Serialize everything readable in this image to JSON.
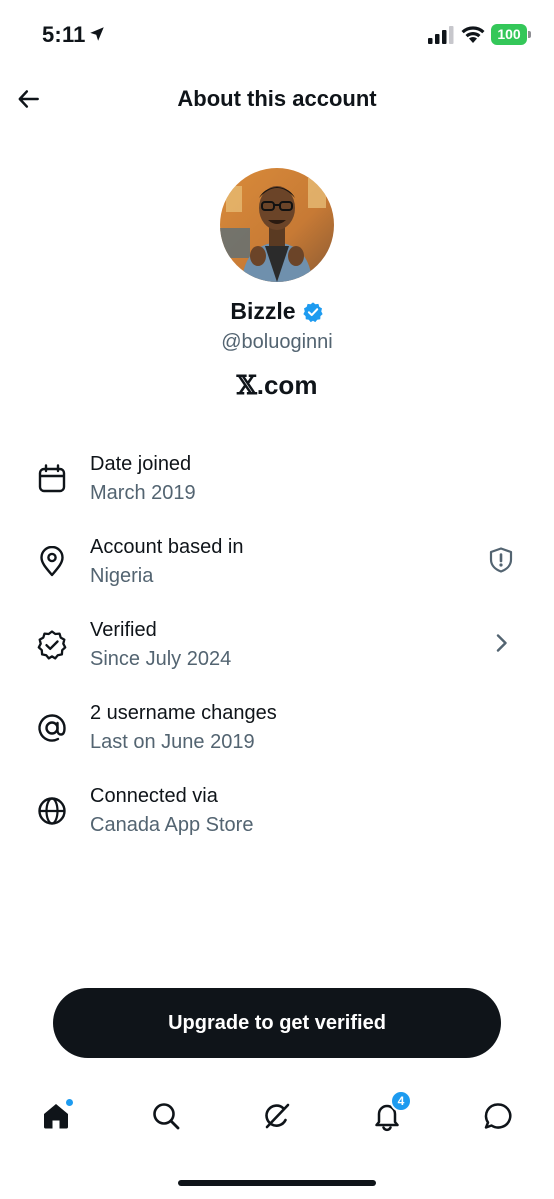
{
  "status_bar": {
    "time": "5:11",
    "battery": "100"
  },
  "header": {
    "title": "About this account"
  },
  "profile": {
    "display_name": "Bizzle",
    "handle": "@boluoginni",
    "brand_mark": "𝕏",
    "brand_suffix": ".com"
  },
  "info_rows": [
    {
      "icon": "calendar-icon",
      "title": "Date joined",
      "subtitle": "March 2019"
    },
    {
      "icon": "location-pin-icon",
      "title": "Account based in",
      "subtitle": "Nigeria",
      "right_icon": "shield-alert-icon"
    },
    {
      "icon": "verified-badge-icon",
      "title": "Verified",
      "subtitle": "Since July 2024",
      "right_icon": "chevron-right-icon"
    },
    {
      "icon": "at-sign-icon",
      "title": "2 username changes",
      "subtitle": "Last on June 2019"
    },
    {
      "icon": "globe-icon",
      "title": "Connected via",
      "subtitle": "Canada App Store"
    }
  ],
  "cta": {
    "label": "Upgrade to get verified"
  },
  "bottom_nav": {
    "items": [
      "home-icon",
      "search-icon",
      "grok-icon",
      "notifications-icon",
      "messages-icon"
    ],
    "notifications_count": "4"
  },
  "colors": {
    "text_primary": "#0f1419",
    "text_secondary": "#536471",
    "accent_blue": "#1d9bf0",
    "battery_green": "#34c759"
  }
}
